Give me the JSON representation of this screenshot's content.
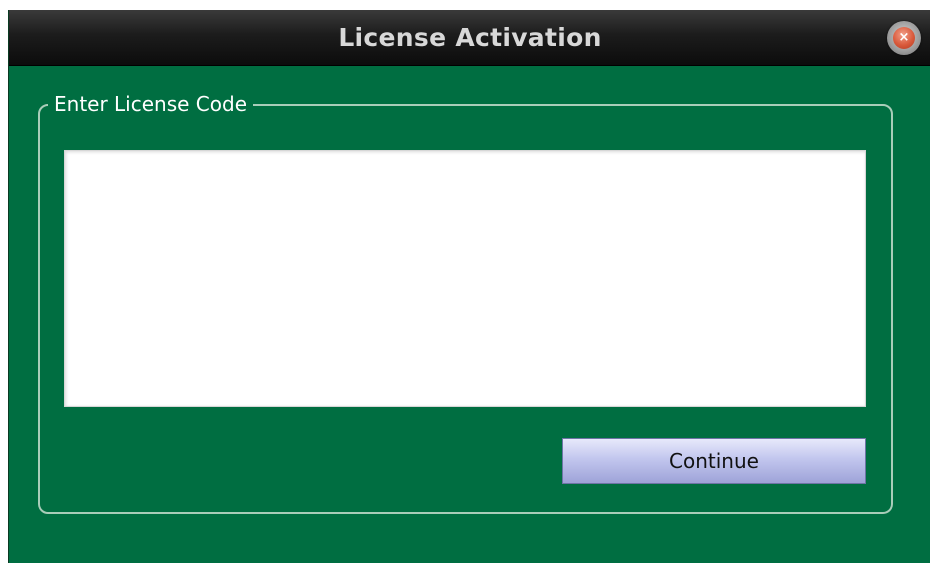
{
  "window": {
    "title": "License Activation"
  },
  "titlebar": {
    "close_icon": "close-icon",
    "close_glyph": "×"
  },
  "license_group": {
    "legend": "Enter License Code",
    "input_value": "",
    "input_placeholder": ""
  },
  "actions": {
    "continue_label": "Continue"
  },
  "colors": {
    "window_background": "#006e41",
    "titlebar_background": "#1c1c1c",
    "title_text": "#d8d8d8",
    "group_border": "#a9cdb9",
    "button_gradient_top": "#e7e9fb",
    "button_gradient_bottom": "#9ea3d8",
    "close_button_red": "#d95a3c"
  }
}
